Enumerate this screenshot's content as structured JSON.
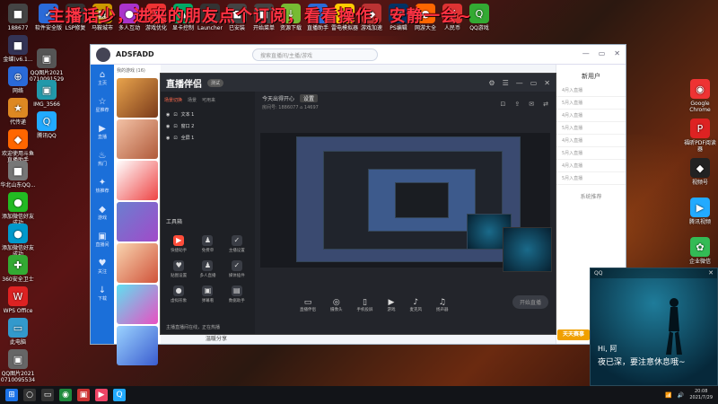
{
  "banner": "主播话少，进来的朋友点个订阅，看看操作，安静一会~",
  "desktop_left": [
    {
      "label": "188677",
      "color": "#444",
      "glyph": "■"
    },
    {
      "label": "金蝶(v6.1...",
      "color": "#335",
      "glyph": "■"
    },
    {
      "label": "网络",
      "color": "#2a6ad8",
      "glyph": "⊕"
    },
    {
      "label": "代传递",
      "color": "#d82",
      "glyph": "★"
    },
    {
      "label": "欢迎使用斗鱼直播助手",
      "color": "#f60",
      "glyph": "◆"
    },
    {
      "label": "华北山东QQ...",
      "color": "#777",
      "glyph": "■"
    },
    {
      "label": "添加微信好友成功",
      "color": "#2b2",
      "glyph": "●"
    },
    {
      "label": "添加微信好友成功",
      "color": "#09c",
      "glyph": "●"
    },
    {
      "label": "360安全卫士",
      "color": "#3a3",
      "glyph": "✚"
    },
    {
      "label": "WPS Office",
      "color": "#d22",
      "glyph": "W"
    },
    {
      "label": "此电脑",
      "color": "#39c",
      "glyph": "▭"
    },
    {
      "label": "QQ图片2021 0710095534",
      "color": "#666",
      "glyph": "▣"
    }
  ],
  "desktop_col2": [
    {
      "label": "QQ图片2021 0710091529",
      "color": "#555",
      "glyph": "▣"
    },
    {
      "label": "IMG_3566",
      "color": "#29a",
      "glyph": "▣"
    },
    {
      "label": "腾讯QQ",
      "color": "#2af",
      "glyph": "Q"
    }
  ],
  "desktop_top": [
    {
      "label": "软件安全版",
      "color": "#2a6ad8",
      "glyph": "✓"
    },
    {
      "label": "LSP修复",
      "color": "#333",
      "glyph": "L"
    },
    {
      "label": "马鞍城市",
      "color": "#c90",
      "glyph": "▦"
    },
    {
      "label": "多人互动",
      "color": "#a3c",
      "glyph": "●"
    },
    {
      "label": "游戏优化",
      "color": "#e33",
      "glyph": "◆"
    },
    {
      "label": "显卡控制",
      "color": "#0a6",
      "glyph": "▲"
    },
    {
      "label": "Launcher",
      "color": "#333",
      "glyph": "◎"
    },
    {
      "label": "已安装",
      "color": "#444",
      "glyph": "■"
    },
    {
      "label": "开始菜单",
      "color": "#444",
      "glyph": "■"
    },
    {
      "label": "资源下载",
      "color": "#7b3",
      "glyph": "↓"
    },
    {
      "label": "直播助手",
      "color": "#2a6ad8",
      "glyph": "▶"
    },
    {
      "label": "雷电模拟器",
      "color": "#fc0",
      "glyph": "⚡"
    },
    {
      "label": "游戏加速",
      "color": "#b33",
      "glyph": "◆"
    },
    {
      "label": "PS编辑",
      "color": "#036",
      "glyph": "Ps"
    },
    {
      "label": "网游大全",
      "color": "#f60",
      "glyph": "●"
    },
    {
      "label": "人民币",
      "color": "#d33",
      "glyph": "¥"
    },
    {
      "label": "QQ游戏",
      "color": "#3a3",
      "glyph": "Q"
    }
  ],
  "desktop_right": [
    {
      "label": "Google Chrome",
      "color": "#e33",
      "glyph": "◉"
    },
    {
      "label": "福昕PDF阅读器",
      "color": "#d22",
      "glyph": "P"
    },
    {
      "label": "视频号",
      "color": "#222",
      "glyph": "◆"
    },
    {
      "label": "腾讯视频",
      "color": "#2af",
      "glyph": "▶"
    },
    {
      "label": "企业微信",
      "color": "#3b5",
      "glyph": "✿"
    }
  ],
  "app": {
    "title": "ADSFADD",
    "search_placeholder": "搜索直播间/主播/游戏",
    "nav": [
      "主页",
      "星推荐",
      "直播",
      "热门",
      "热推荐",
      "游戏",
      "直播间",
      "关注",
      "下载"
    ],
    "game_header": "我的游戏 (16)",
    "right_title": "新用户",
    "right_rows": [
      "4月入直播",
      "5月入直播",
      "4月入直播",
      "5月入直播",
      "4月入直播",
      "5月入直播",
      "4月入直播",
      "5月入直播"
    ],
    "right_sub": "系统推荐",
    "watermark": "温暖分享"
  },
  "stream": {
    "logo": "直播伴侣",
    "badge": "测试",
    "scene_tabs": [
      "场景切换",
      "场景",
      "可用来"
    ],
    "scenes": [
      "文本 1",
      "窗口 2",
      "全屏 1"
    ],
    "tools_title": "工具箱",
    "tools": [
      {
        "label": "快捷助手",
        "glyph": "▶",
        "hot": true
      },
      {
        "label": "免费单",
        "glyph": "♟",
        "hot": false
      },
      {
        "label": "主播设置",
        "glyph": "✓",
        "hot": false
      },
      {
        "label": "贴图设置",
        "glyph": "♥",
        "hot": false
      },
      {
        "label": "多人直播",
        "glyph": "♟",
        "hot": false
      },
      {
        "label": "媒体插件",
        "glyph": "✓",
        "hot": false
      },
      {
        "label": "虚拟形象",
        "glyph": "●",
        "hot": false
      },
      {
        "label": "弹幕看",
        "glyph": "▣",
        "hot": false
      },
      {
        "label": "数据助手",
        "glyph": "▤",
        "hot": false
      }
    ],
    "bottom_msg": "主播直播间在线，正在热播",
    "room_title": "今天出得开心",
    "room_btn": "设置",
    "room_info": "房间号: 1886077    ⌂ 14697",
    "toolbar": [
      {
        "label": "直播伴侣",
        "glyph": "▭"
      },
      {
        "label": "摄像头",
        "glyph": "◎"
      },
      {
        "label": "手机投屏",
        "glyph": "▯"
      },
      {
        "label": "游戏",
        "glyph": "▶"
      },
      {
        "label": "麦克风",
        "glyph": "♪"
      },
      {
        "label": "扬声器",
        "glyph": "♫"
      }
    ],
    "start_button": "开始直播"
  },
  "qq_popup": {
    "title": "QQ",
    "line1": "Hi, 阿",
    "line2": "夜已深，要注意休息哦~"
  },
  "tiantian": "天天赛事",
  "taskbar": {
    "apps": [
      {
        "glyph": "⊞",
        "color": "#1b73e8"
      },
      {
        "glyph": "○",
        "color": "#333"
      },
      {
        "glyph": "▭",
        "color": "#333"
      },
      {
        "glyph": "◉",
        "color": "#1f8a3c"
      },
      {
        "glyph": "▣",
        "color": "#c33"
      },
      {
        "glyph": "▶",
        "color": "#e46"
      },
      {
        "glyph": "Q",
        "color": "#2af"
      }
    ],
    "time": "20:08",
    "date": "2021/7/29"
  }
}
